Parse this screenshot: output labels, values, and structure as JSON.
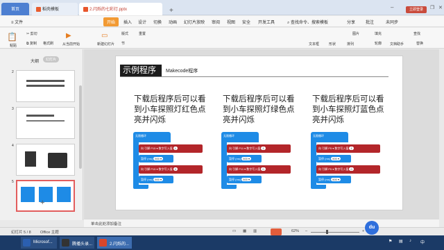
{
  "titlebar": {
    "tabs": [
      {
        "label": "首页"
      },
      {
        "label": "稻壳模板"
      },
      {
        "label": "2.闪烁的七彩灯.pptx"
      }
    ],
    "add_tab": "+",
    "login": "立即登录",
    "controls": [
      "–",
      "❐",
      "✕"
    ]
  },
  "menubar": {
    "file": "≡ 文件",
    "start": "开始",
    "items": [
      "插入",
      "设计",
      "切换",
      "动画",
      "幻灯片放映",
      "审阅",
      "视图",
      "安全",
      "开发工具"
    ],
    "search": "查找命令、搜索模板",
    "share": "分享",
    "comment": "批注",
    "sync": "未同步"
  },
  "toolbar": {
    "paste": "粘贴",
    "cut": "剪切",
    "copy": "复制",
    "format_painter": "格式刷",
    "from_current": "从当前开始",
    "new_slide": "新建幻灯片",
    "layout": "版式",
    "section": "节",
    "reset": "重置",
    "textbox": "文本框",
    "shape": "形状",
    "arrange": "排列",
    "picture": "图片",
    "fill": "填充",
    "outline": "轮廓",
    "find": "查找",
    "replace": "替换",
    "arrange2": "文档助手"
  },
  "leftpanel": {
    "tab_outline": "大纲",
    "tab_slides": "幻灯片",
    "slide_numbers": [
      "2",
      "3",
      "4",
      "5"
    ],
    "add": "+"
  },
  "slide": {
    "title": "示例程序",
    "subtitle": "Makecode程序",
    "descriptions": [
      "下载后程序后可以看到小车探照灯红色点亮并闪烁",
      "下载后程序后可以看到小车探照灯绿色点亮并闪烁",
      "下载后程序后可以看到小车探照灯蓝色点亮并闪烁"
    ],
    "blocks": [
      {
        "head": "无限循环",
        "set1": "向 引脚 P15 ▾ 数字写入值",
        "v1": "1",
        "pause1": "暂停 (ms)",
        "ms1": "500 ▾",
        "set2": "向 引脚 P15 ▾ 数字写入值",
        "v2": "0",
        "pause2": "暂停 (ms)",
        "ms2": "500 ▾"
      },
      {
        "head": "无限循环",
        "set1": "向 引脚 P11 ▾ 数字写入值",
        "v1": "1",
        "pause1": "暂停 (ms)",
        "ms1": "500 ▾",
        "set2": "向 引脚 P11 ▾ 数字写入值",
        "v2": "0",
        "pause2": "暂停 (ms)",
        "ms2": "500 ▾"
      },
      {
        "head": "无限循环",
        "set1": "向 引脚 P5 ▾ 数字写入值",
        "v1": "1",
        "pause1": "暂停 (ms)",
        "ms1": "500 ▾",
        "set2": "向 引脚 P5 ▾ 数字写入值",
        "v2": "0",
        "pause2": "暂停 (ms)",
        "ms2": "500 ▾"
      }
    ]
  },
  "notes": {
    "placeholder": "单击此处添加备注"
  },
  "statusbar": {
    "slide_count": "幻灯片 5 / 8",
    "theme": "Office 主题",
    "zoom": "62%",
    "zoom_minus": "–",
    "zoom_plus": "+"
  },
  "taskbar": {
    "items": [
      "Microsof...",
      "腾播头录...",
      "2.闪烁的..."
    ],
    "ime": "中",
    "time": "",
    "colors": {
      "accent": "#1e8be6",
      "pin_red": "#b3262a",
      "start_orange": "#f29a33"
    }
  }
}
